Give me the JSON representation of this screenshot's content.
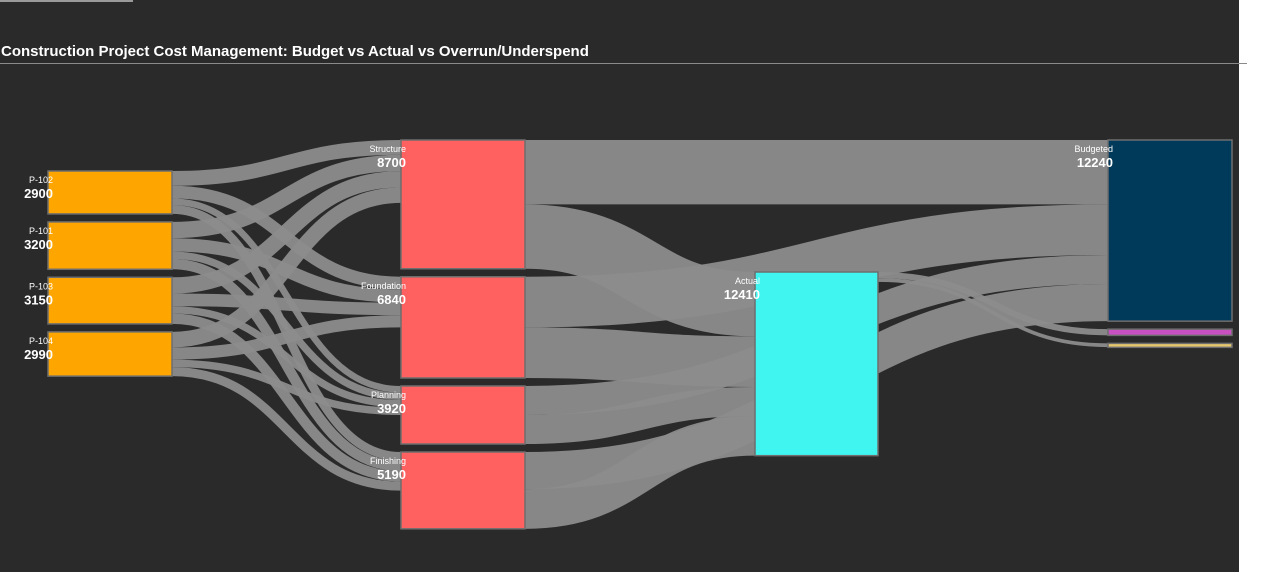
{
  "title": "Construction Project Cost Management: Budget vs Actual vs Overrun/Underspend",
  "chart_data": {
    "type": "sankey",
    "title": "Construction Project Cost Management: Budget vs Actual vs Overrun/Underspend",
    "colors": {
      "project": "#ffa500",
      "phase": "#ff6161",
      "actual": "#40f4ef",
      "budgeted": "#003a5a",
      "overrun": "#c850c0",
      "underspend": "#e6c66e",
      "link": "#8c8c8c",
      "background": "#2a2a2a"
    },
    "nodes": [
      {
        "id": "P-102",
        "label": "P-102",
        "value": 2900,
        "column": 0
      },
      {
        "id": "P-101",
        "label": "P-101",
        "value": 3200,
        "column": 0
      },
      {
        "id": "P-103",
        "label": "P-103",
        "value": 3150,
        "column": 0
      },
      {
        "id": "P-104",
        "label": "P-104",
        "value": 2990,
        "column": 0
      },
      {
        "id": "Structure",
        "label": "Structure",
        "value": 8700,
        "column": 1
      },
      {
        "id": "Foundation",
        "label": "Foundation",
        "value": 6840,
        "column": 1
      },
      {
        "id": "Planning",
        "label": "Planning",
        "value": 3920,
        "column": 1
      },
      {
        "id": "Finishing",
        "label": "Finishing",
        "value": 5190,
        "column": 1
      },
      {
        "id": "Actual",
        "label": "Actual",
        "value": 12410,
        "column": 2
      },
      {
        "id": "Budgeted",
        "label": "Budgeted",
        "value": 12240,
        "column": 3
      },
      {
        "id": "Overrun",
        "label": "",
        "value": 420,
        "column": 3
      },
      {
        "id": "Underspend",
        "label": "",
        "value": 250,
        "column": 3
      }
    ],
    "links": [
      {
        "source": "P-102",
        "target": "Structure",
        "value": 1000
      },
      {
        "source": "P-102",
        "target": "Foundation",
        "value": 850
      },
      {
        "source": "P-102",
        "target": "Planning",
        "value": 450
      },
      {
        "source": "P-102",
        "target": "Finishing",
        "value": 600
      },
      {
        "source": "P-101",
        "target": "Structure",
        "value": 1100
      },
      {
        "source": "P-101",
        "target": "Foundation",
        "value": 900
      },
      {
        "source": "P-101",
        "target": "Planning",
        "value": 500
      },
      {
        "source": "P-101",
        "target": "Finishing",
        "value": 700
      },
      {
        "source": "P-103",
        "target": "Structure",
        "value": 1100
      },
      {
        "source": "P-103",
        "target": "Foundation",
        "value": 850
      },
      {
        "source": "P-103",
        "target": "Planning",
        "value": 500
      },
      {
        "source": "P-103",
        "target": "Finishing",
        "value": 700
      },
      {
        "source": "P-104",
        "target": "Structure",
        "value": 1050
      },
      {
        "source": "P-104",
        "target": "Foundation",
        "value": 820
      },
      {
        "source": "P-104",
        "target": "Planning",
        "value": 510
      },
      {
        "source": "P-104",
        "target": "Finishing",
        "value": 610
      },
      {
        "source": "Structure",
        "target": "Budgeted",
        "value": 4350
      },
      {
        "source": "Structure",
        "target": "Actual",
        "value": 4350
      },
      {
        "source": "Foundation",
        "target": "Budgeted",
        "value": 3420
      },
      {
        "source": "Foundation",
        "target": "Actual",
        "value": 3420
      },
      {
        "source": "Planning",
        "target": "Budgeted",
        "value": 1960
      },
      {
        "source": "Planning",
        "target": "Actual",
        "value": 1960
      },
      {
        "source": "Finishing",
        "target": "Budgeted",
        "value": 2510
      },
      {
        "source": "Finishing",
        "target": "Actual",
        "value": 2680
      },
      {
        "source": "Actual",
        "target": "Overrun",
        "value": 420
      },
      {
        "source": "Actual",
        "target": "Underspend",
        "value": 250
      }
    ]
  }
}
